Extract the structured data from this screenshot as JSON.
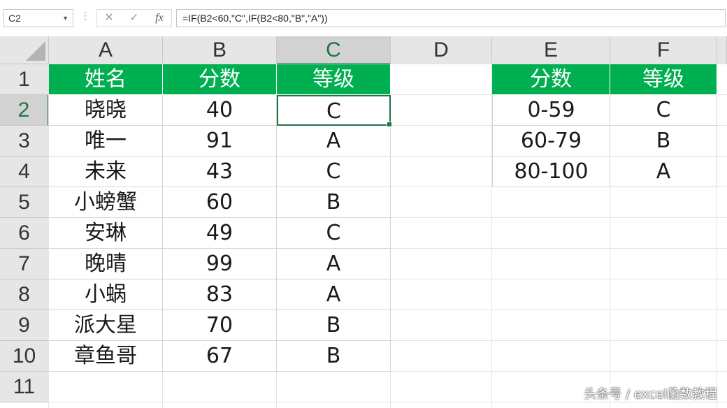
{
  "formula_bar": {
    "name_box": "C2",
    "cancel_glyph": "✕",
    "enter_glyph": "✓",
    "fx_glyph": "fx",
    "formula": "=IF(B2<60,\"C\",IF(B2<80,\"B\",\"A\"))"
  },
  "columns": [
    "A",
    "B",
    "C",
    "D",
    "E",
    "F"
  ],
  "rows": [
    "1",
    "2",
    "3",
    "4",
    "5",
    "6",
    "7",
    "8",
    "9",
    "10",
    "11"
  ],
  "active_cell": "C2",
  "main_table": {
    "headers": [
      "姓名",
      "分数",
      "等级"
    ],
    "rows": [
      [
        "晓晓",
        "40",
        "C"
      ],
      [
        "唯一",
        "91",
        "A"
      ],
      [
        "未来",
        "43",
        "C"
      ],
      [
        "小螃蟹",
        "60",
        "B"
      ],
      [
        "安琳",
        "49",
        "C"
      ],
      [
        "晚晴",
        "99",
        "A"
      ],
      [
        "小蜗",
        "83",
        "A"
      ],
      [
        "派大星",
        "70",
        "B"
      ],
      [
        "章鱼哥",
        "67",
        "B"
      ]
    ]
  },
  "lookup_table": {
    "headers": [
      "分数",
      "等级"
    ],
    "rows": [
      [
        "0-59",
        "C"
      ],
      [
        "60-79",
        "B"
      ],
      [
        "80-100",
        "A"
      ]
    ]
  },
  "watermark": "头条号 / excel函数教程",
  "colors": {
    "header_fill": "#00b050",
    "selection": "#217346",
    "header_text": "#ffffff"
  }
}
